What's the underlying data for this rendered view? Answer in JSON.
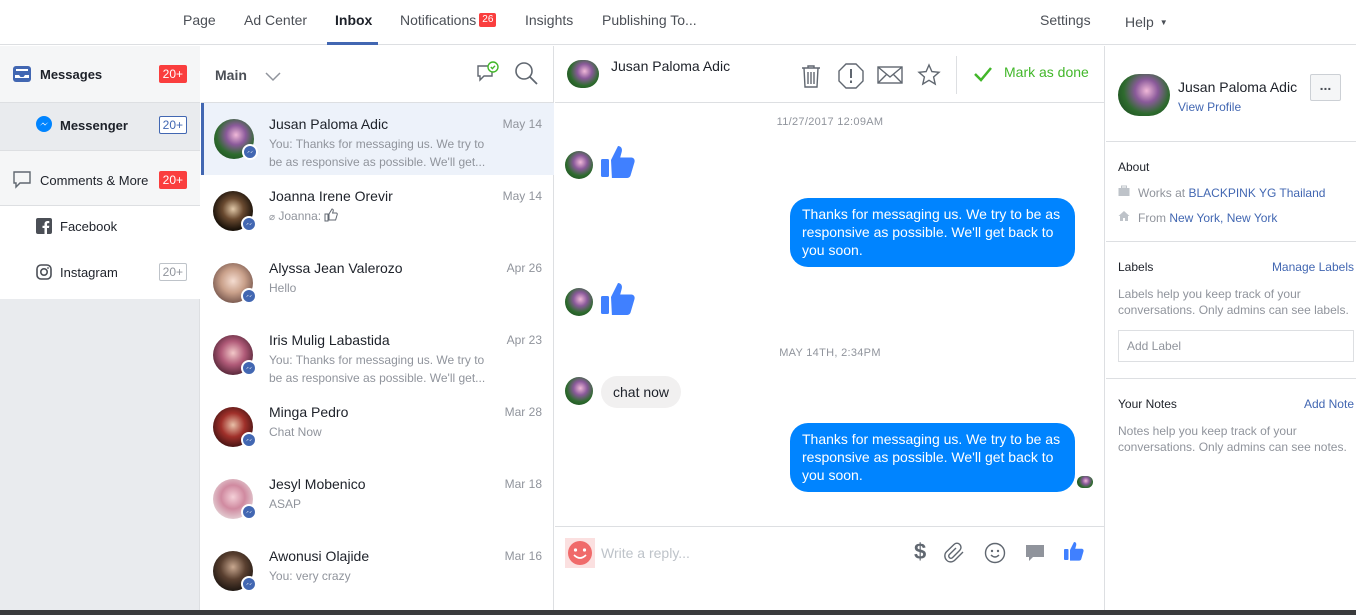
{
  "nav": {
    "page": "Page",
    "ad_center": "Ad Center",
    "inbox": "Inbox",
    "notifications": "Notifications",
    "notifications_count": "26",
    "insights": "Insights",
    "publishing": "Publishing To...",
    "settings": "Settings",
    "help": "Help"
  },
  "sidebar": {
    "messages": "Messages",
    "messages_badge": "20+",
    "messenger": "Messenger",
    "messenger_badge": "20+",
    "comments": "Comments & More",
    "comments_badge": "20+",
    "facebook": "Facebook",
    "instagram": "Instagram",
    "instagram_badge": "20+"
  },
  "conversation_list": {
    "filter": "Main",
    "items": [
      {
        "name": "Jusan Paloma Adic",
        "date": "May 14",
        "snippet": "You: Thanks for messaging us. We try to be as responsive as possible. We'll get..."
      },
      {
        "name": "Joanna Irene Orevir",
        "date": "May 14",
        "snippet": "Joanna:"
      },
      {
        "name": "Alyssa Jean Valerozo",
        "date": "Apr 26",
        "snippet": "Hello"
      },
      {
        "name": "Iris Mulig Labastida",
        "date": "Apr 23",
        "snippet": "You: Thanks for messaging us. We try to be as responsive as possible. We'll get..."
      },
      {
        "name": "Minga Pedro",
        "date": "Mar 28",
        "snippet": "Chat Now"
      },
      {
        "name": "Jesyl Mobenico",
        "date": "Mar 18",
        "snippet": "ASAP"
      },
      {
        "name": "Awonusi Olajide",
        "date": "Mar 16",
        "snippet": "You: very crazy"
      }
    ]
  },
  "chat": {
    "name": "Jusan Paloma Adic",
    "mark_done": "Mark as done",
    "timestamp1": "11/27/2017 12:09AM",
    "auto_reply": "Thanks for messaging us. We try to be as responsive as possible. We'll get back to you soon.",
    "timestamp2": "MAY 14TH, 2:34PM",
    "incoming_text": "chat now",
    "auto_reply2": "Thanks for messaging us. We try to be as responsive as possible. We'll get back to you soon.",
    "reply_placeholder": "Write a reply..."
  },
  "profile": {
    "name": "Jusan Paloma Adic",
    "view_profile": "View Profile",
    "more": "...",
    "about_title": "About",
    "works_prefix": "Works at",
    "works_at": "BLACKPINK YG Thailand",
    "from_prefix": "From",
    "from": "New York, New York",
    "labels_title": "Labels",
    "manage_labels": "Manage Labels",
    "labels_help": "Labels help you keep track of your conversations. Only admins can see labels.",
    "add_label_placeholder": "Add Label",
    "notes_title": "Your Notes",
    "add_note": "Add Note",
    "notes_help": "Notes help you keep track of your conversations. Only admins can see notes."
  },
  "colors": {
    "accent": "#4267b2",
    "messenger_blue": "#0084ff",
    "badge_red": "#fa3e3e",
    "done_green": "#42b72a"
  }
}
